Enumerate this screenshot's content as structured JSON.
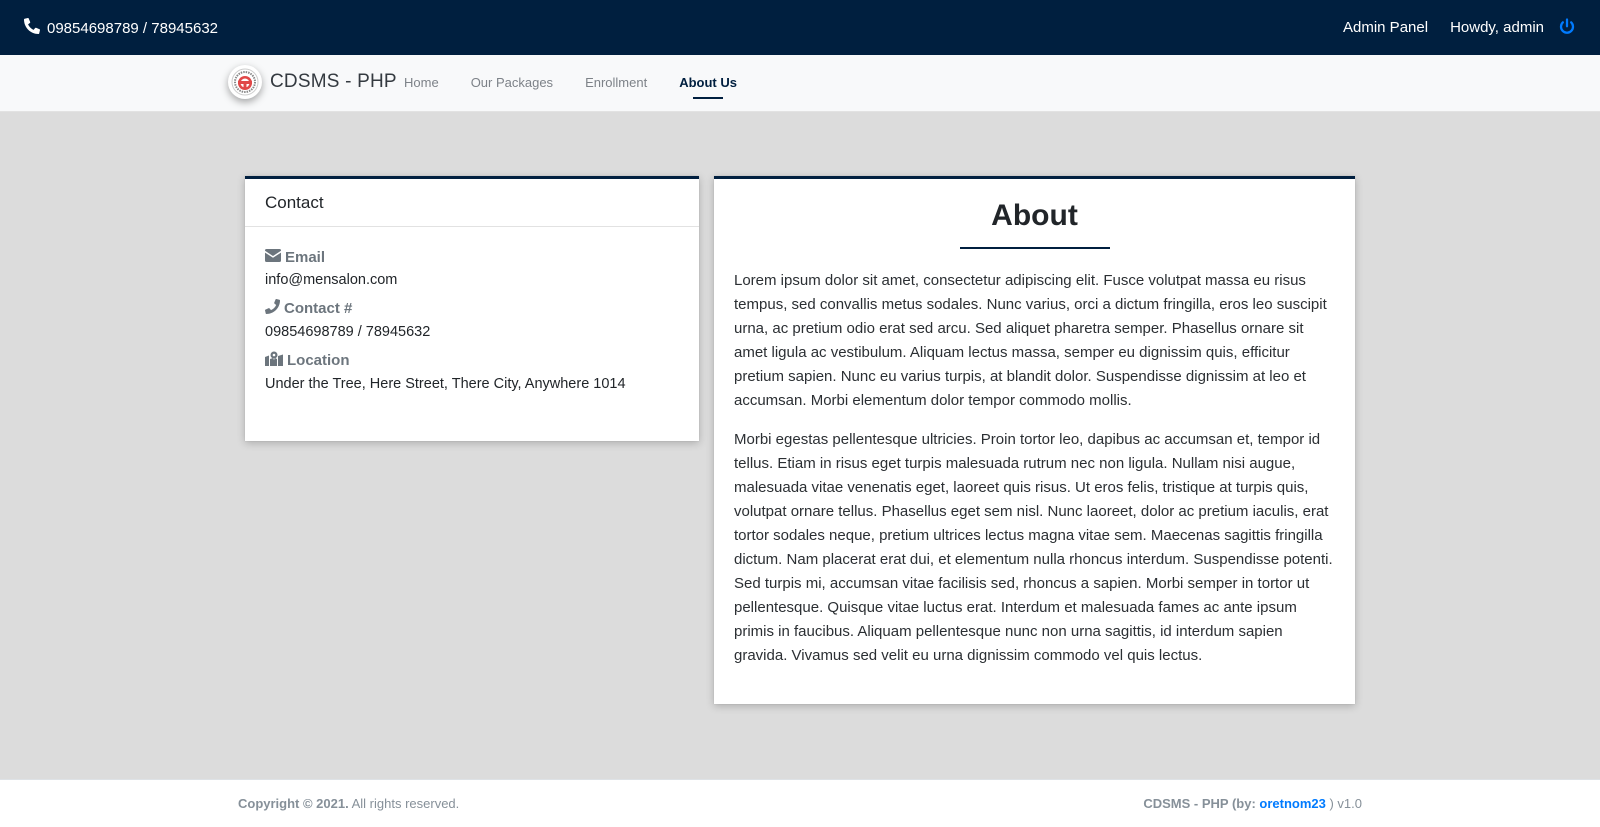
{
  "topbar": {
    "phone_icon": "phone-icon",
    "phone": "09854698789 / 78945632",
    "admin_panel": "Admin Panel",
    "howdy": "Howdy, admin",
    "logout_icon": "power-icon",
    "logout_color": "#007bff",
    "bg_color": "#001f3f"
  },
  "navbar": {
    "brand": "CDSMS - PHP",
    "logo_icon": "steering-wheel-logo",
    "links": [
      {
        "label": "Home",
        "active": false
      },
      {
        "label": "Our Packages",
        "active": false
      },
      {
        "label": "Enrollment",
        "active": false
      },
      {
        "label": "About Us",
        "active": true
      }
    ]
  },
  "contact": {
    "title": "Contact",
    "items": [
      {
        "icon": "envelope-icon",
        "label": "Email",
        "value": "info@mensalon.com"
      },
      {
        "icon": "phone-icon",
        "label": "Contact #",
        "value": "09854698789 / 78945632"
      },
      {
        "icon": "map-marked-icon",
        "label": "Location",
        "value": "Under the Tree, Here Street, There City, Anywhere 1014"
      }
    ]
  },
  "about": {
    "title": "About",
    "paragraphs": [
      "Lorem ipsum dolor sit amet, consectetur adipiscing elit. Fusce volutpat massa eu risus tempus, sed convallis metus sodales. Nunc varius, orci a dictum fringilla, eros leo suscipit urna, ac pretium odio erat sed arcu. Sed aliquet pharetra semper. Phasellus ornare sit amet ligula ac vestibulum. Aliquam lectus massa, semper eu dignissim quis, efficitur pretium sapien. Nunc eu varius turpis, at blandit dolor. Suspendisse dignissim at leo et accumsan. Morbi elementum dolor tempor commodo mollis.",
      "Morbi egestas pellentesque ultricies. Proin tortor leo, dapibus ac accumsan et, tempor id tellus. Etiam in risus eget turpis malesuada rutrum nec non ligula. Nullam nisi augue, malesuada vitae venenatis eget, laoreet quis risus. Ut eros felis, tristique at turpis quis, volutpat ornare tellus. Phasellus eget sem nisl. Nunc laoreet, dolor ac pretium iaculis, erat tortor sodales neque, pretium ultrices lectus magna vitae sem. Maecenas sagittis fringilla dictum. Nam placerat erat dui, et elementum nulla rhoncus interdum. Suspendisse potenti. Sed turpis mi, accumsan vitae facilisis sed, rhoncus a sapien. Morbi semper in tortor ut pellentesque. Quisque vitae luctus erat. Interdum et malesuada fames ac ante ipsum primis in faucibus. Aliquam pellentesque nunc non urna sagittis, id interdum sapien gravida. Vivamus sed velit eu urna dignissim commodo vel quis lectus."
    ]
  },
  "footer": {
    "copyright_bold": "Copyright © 2021.",
    "copyright_rest": " All rights reserved.",
    "credit_prefix": "CDSMS - PHP (by: ",
    "credit_author": "oretnom23",
    "credit_suffix": " ) v1.0",
    "link_color": "#007bff"
  }
}
